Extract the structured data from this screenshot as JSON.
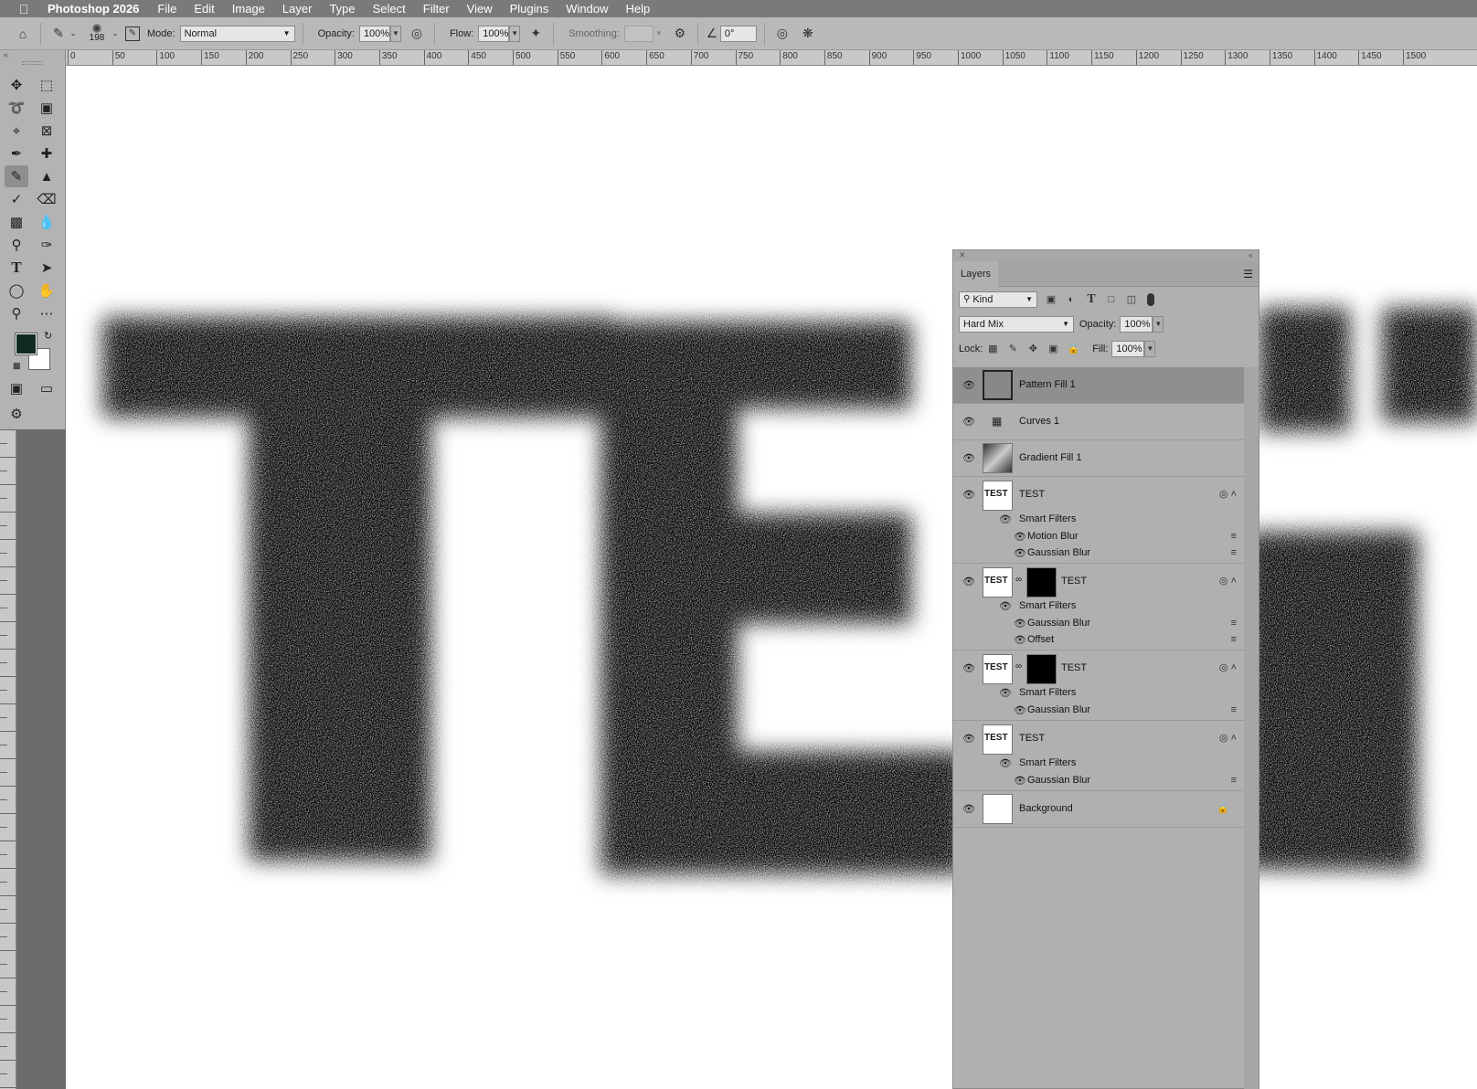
{
  "menubar": {
    "apple": "",
    "app_name": "Photoshop 2026",
    "menus": [
      "File",
      "Edit",
      "Image",
      "Layer",
      "Type",
      "Select",
      "Filter",
      "View",
      "Plugins",
      "Window",
      "Help"
    ]
  },
  "options": {
    "brush_size": "198",
    "mode_label": "Mode:",
    "mode_value": "Normal",
    "opacity_label": "Opacity:",
    "opacity_value": "100%",
    "flow_label": "Flow:",
    "flow_value": "100%",
    "smoothing_label": "Smoothing:",
    "smoothing_value": "",
    "angle_value": "0°"
  },
  "ruler": {
    "labels": [
      "0",
      "50",
      "100",
      "150",
      "200",
      "250",
      "300",
      "350",
      "400",
      "450",
      "500",
      "550",
      "600",
      "650",
      "700",
      "750",
      "800",
      "850",
      "900",
      "950",
      "1000",
      "1050",
      "1100",
      "1150",
      "1200",
      "1250",
      "1300",
      "1350",
      "1400",
      "1450",
      "1500"
    ]
  },
  "colors": {
    "foreground": "#0f2a22",
    "background": "#ffffff"
  },
  "layers_panel": {
    "tab_label": "Layers",
    "filter_kind": "Kind",
    "blend_mode": "Hard Mix",
    "opacity_label": "Opacity:",
    "opacity_value": "100%",
    "lock_label": "Lock:",
    "fill_label": "Fill:",
    "fill_value": "100%",
    "layers": [
      {
        "name": "Pattern Fill 1",
        "selected": true
      },
      {
        "name": "Curves 1"
      },
      {
        "name": "Gradient Fill 1"
      },
      {
        "name": "TEST",
        "smart_filters": "Smart Filters",
        "filters": [
          "Motion Blur",
          "Gaussian Blur"
        ]
      },
      {
        "name": "TEST",
        "smart_filters": "Smart Filters",
        "filters": [
          "Gaussian Blur",
          "Offset"
        ]
      },
      {
        "name": "TEST",
        "smart_filters": "Smart Filters",
        "filters": [
          "Gaussian Blur"
        ]
      },
      {
        "name": "TEST",
        "smart_filters": "Smart Filters",
        "filters": [
          "Gaussian Blur"
        ]
      },
      {
        "name": "Background"
      }
    ]
  }
}
